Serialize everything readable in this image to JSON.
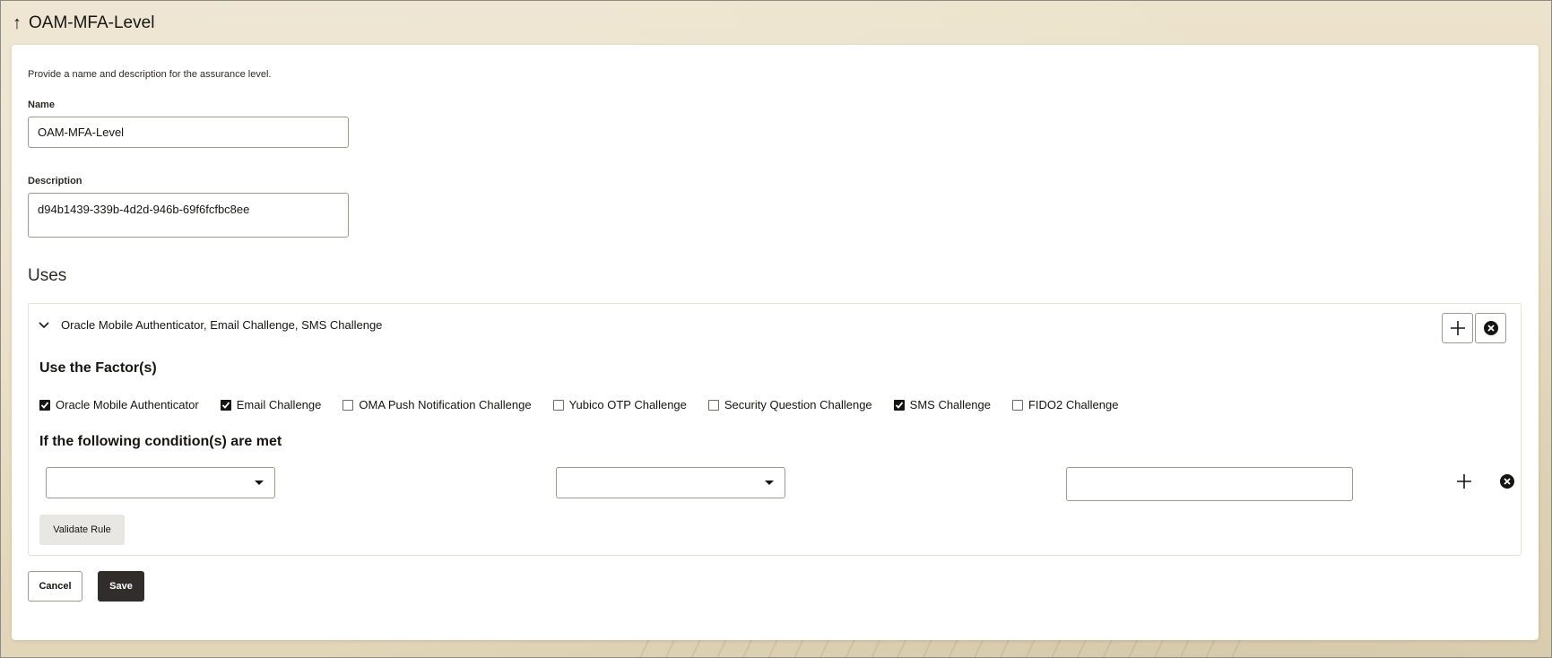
{
  "header": {
    "back_icon": "arrow-up-icon",
    "title": "OAM-MFA-Level"
  },
  "form": {
    "intro": "Provide a name and description for the assurance level.",
    "name_label": "Name",
    "name_value": "OAM-MFA-Level",
    "description_label": "Description",
    "description_value": "d94b1439-339b-4d2d-946b-69f6fcfbc8ee"
  },
  "uses": {
    "heading": "Uses",
    "rule": {
      "summary": "Oracle Mobile Authenticator, Email Challenge, SMS Challenge",
      "factors_heading": "Use the Factor(s)",
      "factors": [
        {
          "label": "Oracle Mobile Authenticator",
          "checked": true
        },
        {
          "label": "Email Challenge",
          "checked": true
        },
        {
          "label": "OMA Push Notification Challenge",
          "checked": false
        },
        {
          "label": "Yubico OTP Challenge",
          "checked": false
        },
        {
          "label": "Security Question Challenge",
          "checked": false
        },
        {
          "label": "SMS Challenge",
          "checked": true
        },
        {
          "label": "FIDO2 Challenge",
          "checked": false
        }
      ],
      "conditions_heading": "If the following condition(s) are met",
      "condition": {
        "attribute": "",
        "operator": "",
        "value": ""
      },
      "validate_label": "Validate Rule"
    }
  },
  "actions": {
    "cancel_label": "Cancel",
    "save_label": "Save"
  },
  "colors": {
    "primary_button": "#312d2a",
    "page_background": "#e6dcc3",
    "checkbox_checked": "#161513"
  }
}
